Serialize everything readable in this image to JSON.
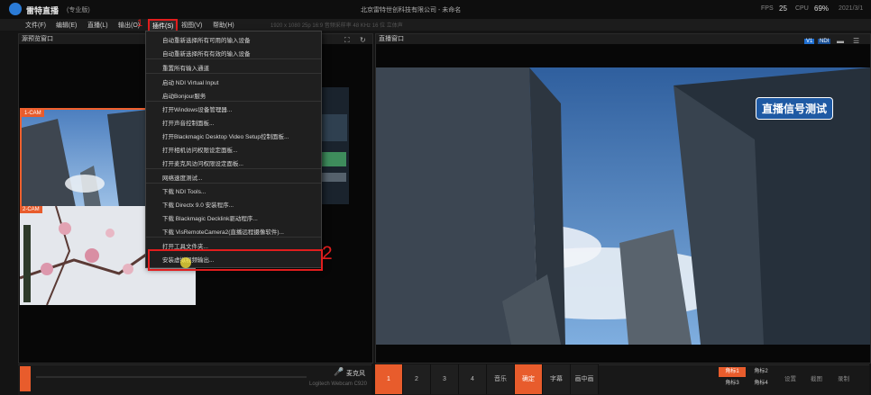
{
  "app": {
    "name": "雷特直播",
    "edition": "(专业版)",
    "window_title": "北京雷特世创科技有限公司 - 未命名"
  },
  "status": {
    "fps_label": "FPS",
    "fps_value": "25",
    "cpu_label": "CPU",
    "cpu_value": "69%",
    "date": "2021/3/1"
  },
  "menubar": {
    "items": [
      "文件(F)",
      "编辑(E)",
      "直播(L)",
      "输出(O)",
      "插件(S)",
      "视图(V)",
      "帮助(H)"
    ],
    "tools_label": "插件(S)",
    "step1_label": "1",
    "info_text": "1920 x 1080 25p 16:9 音频采样率 48 KHz 16 位 立体声"
  },
  "panes": {
    "source_title": "源预览窗口",
    "output_title": "直播窗口"
  },
  "cameras": [
    {
      "tag": "1-CAM"
    },
    {
      "tag": "2-CAM"
    }
  ],
  "dropdown": {
    "items": [
      "自动重新选择所有可用的输入设备",
      "自动重新选择所有有效的输入设备",
      "重置所有输入通道",
      "启动 NDI Virtual Input",
      "启动Bonjour服务",
      "打开Windows设备管理器...",
      "打开声音控制面板...",
      "打开Blackmagic Desktop Video Setup控制面板...",
      "打开相机访问权限设定面板...",
      "打开麦克风访问权限设定面板...",
      "网络速度测试...",
      "下载 NDI Tools...",
      "下载 Directx 9.0 安装程序...",
      "下载 Blackmagic Decklink驱动程序...",
      "下载 VisRemoteCamera2(直播远程摄像软件)...",
      "打开工具文件夹...",
      "安装虚拟视频输出..."
    ],
    "step2_label": "2"
  },
  "output": {
    "overlay_text": "直播信号测试",
    "badges": [
      "V1",
      "NDI"
    ]
  },
  "audio": {
    "mic_label": "麦克风",
    "device_text": "Logitech Webcam C920"
  },
  "controls": {
    "buttons": [
      "1",
      "2",
      "3",
      "4",
      "音乐",
      "确定",
      "字幕",
      "画中画"
    ],
    "active_button": "确定",
    "angles": [
      "角标1",
      "角标2",
      "角标3",
      "角标4"
    ],
    "tools": [
      "设置",
      "截图",
      "录制"
    ]
  },
  "colors": {
    "accent": "#e85c2c",
    "highlight": "#e11d1d",
    "brand_blue": "#2b7bd6"
  }
}
